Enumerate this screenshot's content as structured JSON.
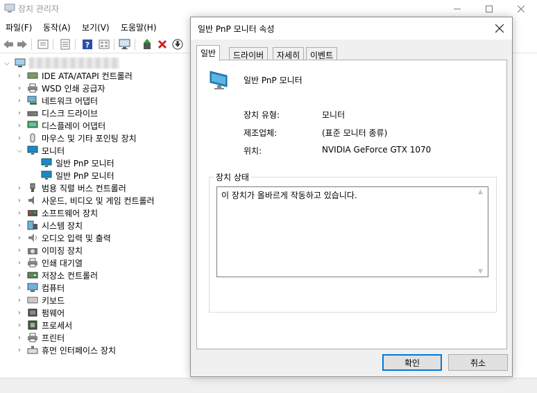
{
  "window": {
    "title": "장치 관리자"
  },
  "menu": [
    "파일(F)",
    "동작(A)",
    "보기(V)",
    "도움말(H)"
  ],
  "toolbar_icons": [
    "back-arrow-icon",
    "forward-arrow-icon",
    "properties-icon",
    "driver-icon",
    "help-icon",
    "view-icon",
    "monitor-scan-icon",
    "update-driver-icon",
    "uninstall-icon",
    "disable-icon"
  ],
  "tree": {
    "items": [
      "IDE ATA/ATAPI 컨트롤러",
      "WSD 인쇄 공급자",
      "네트워크 어댑터",
      "디스크 드라이브",
      "디스플레이 어댑터",
      "마우스 및 기타 포인팅 장치",
      "모니터",
      "일반 PnP 모니터",
      "일반 PnP 모니터",
      "범용 직렬 버스 컨트롤러",
      "사운드, 비디오 및 게임 컨트롤러",
      "소프트웨어 장치",
      "시스템 장치",
      "오디오 입력 및 출력",
      "이미징 장치",
      "인쇄 대기열",
      "저장소 컨트롤러",
      "컴퓨터",
      "키보드",
      "펌웨어",
      "프로세서",
      "프린터",
      "휴먼 인터페이스 장치"
    ]
  },
  "dialog": {
    "title": "일반 PnP 모니터 속성",
    "tabs": [
      "일반",
      "드라이버",
      "자세히",
      "이벤트"
    ],
    "device_name": "일반 PnP 모니터",
    "props": [
      {
        "label": "장치 유형:",
        "value": "모니터"
      },
      {
        "label": "제조업체:",
        "value": "(표준 모니터 종류)"
      },
      {
        "label": "위치:",
        "value": "NVIDIA GeForce GTX 1070"
      }
    ],
    "status_group": "장치 상태",
    "status_text": "이 장치가 올바르게 작동하고 있습니다.",
    "ok": "확인",
    "cancel": "취소"
  },
  "colors": {
    "accent": "#0078d7",
    "monitor_blue": "#1e88c8"
  }
}
